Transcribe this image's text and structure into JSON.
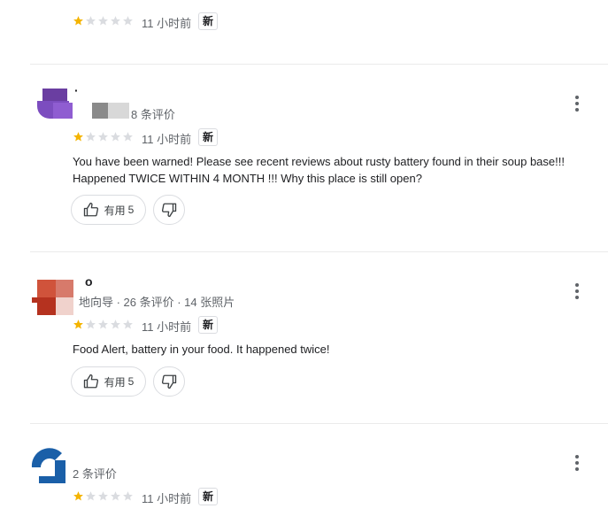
{
  "colors": {
    "star_on": "#f4b400",
    "star_off": "#dadce0",
    "accent_blue": "#1a5fa8"
  },
  "reviews": [
    {
      "rating": 1,
      "max_rating": 5,
      "time": "11 小时前",
      "new_badge": "新"
    },
    {
      "reviewer_name": "·",
      "meta": "8 条评价",
      "rating": 1,
      "max_rating": 5,
      "time": "11 小时前",
      "new_badge": "新",
      "text": "You have been warned! Please see recent reviews about rusty battery found in their soup base!!! Happened TWICE WITHIN 4 MONTH !!! Why this place is still open?",
      "helpful_label": "有用",
      "helpful_count": "5"
    },
    {
      "reviewer_name": "o",
      "meta": "地向导 · 26 条评价 · 14 张照片",
      "rating": 1,
      "max_rating": 5,
      "time": "11 小时前",
      "new_badge": "新",
      "text": "Food Alert, battery in your food. It happened twice!",
      "helpful_label": "有用",
      "helpful_count": "5"
    },
    {
      "meta": "2 条评价",
      "rating": 1,
      "max_rating": 5,
      "time": "11 小时前",
      "new_badge": "新"
    }
  ]
}
